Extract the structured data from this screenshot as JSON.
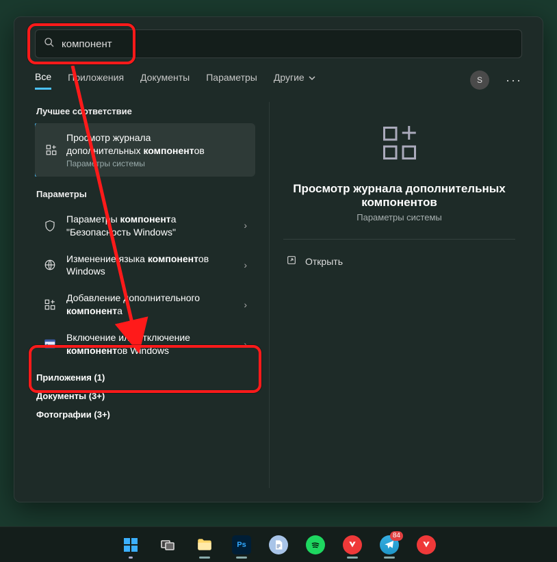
{
  "search": {
    "query": "компонент"
  },
  "tabs": {
    "all": "Все",
    "apps": "Приложения",
    "docs": "Документы",
    "settings": "Параметры",
    "more": "Другие"
  },
  "avatar_letter": "S",
  "sections": {
    "best_match_header": "Лучшее соответствие",
    "best_match": {
      "line1": "Просмотр журнала",
      "line2_pre": "дополнительных ",
      "line2_b": "компонент",
      "line2_post": "ов",
      "sub": "Параметры системы"
    },
    "settings_header": "Параметры",
    "settings_items": [
      {
        "pre": "Параметры ",
        "b": "компонент",
        "post": "а \"Безопасность Windows\""
      },
      {
        "pre": "Изменение языка ",
        "b": "компонент",
        "post": "ов Windows"
      },
      {
        "pre": "Добавление дополнительного ",
        "b": "компонент",
        "post": "а"
      },
      {
        "pre": "Включение или отключение ",
        "b": "компонент",
        "post": "ов Windows"
      }
    ],
    "categories": {
      "apps": "Приложения (1)",
      "docs": "Документы (3+)",
      "photos": "Фотографии (3+)"
    }
  },
  "preview": {
    "title": "Просмотр журнала дополнительных компонентов",
    "sub": "Параметры системы",
    "open": "Открыть"
  },
  "taskbar": {
    "telegram_badge": "84"
  }
}
